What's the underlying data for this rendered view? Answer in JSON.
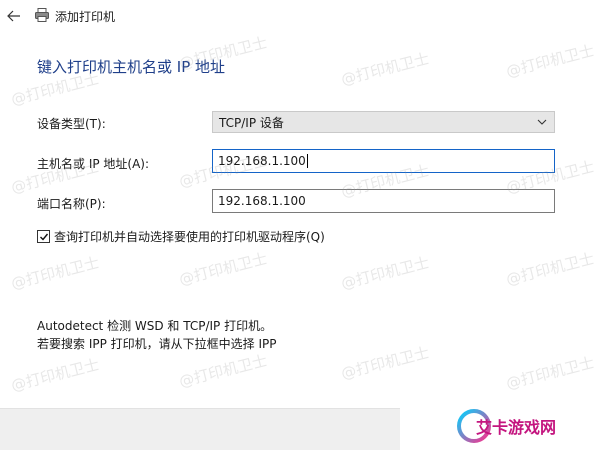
{
  "window": {
    "title": "添加打印机"
  },
  "heading": "键入打印机主机名或 IP 地址",
  "form": {
    "device_type_label": "设备类型(T):",
    "device_type_value": "TCP/IP 设备",
    "hostname_label": "主机名或 IP 地址(A):",
    "hostname_value": "192.168.1.100",
    "port_label": "端口名称(P):",
    "port_value": "192.168.1.100",
    "query_driver_label": "查询打印机并自动选择要使用的打印机驱动程序(Q)",
    "query_driver_checked": true
  },
  "info": {
    "line1": "Autodetect 检测 WSD 和 TCP/IP 打印机。",
    "line2": "若要搜索 IPP 打印机，请从下拉框中选择 IPP"
  },
  "watermark": {
    "text": "@打印机卫士"
  },
  "logo": {
    "text": "艾卡游戏网"
  },
  "icons": {
    "back": "back-arrow-icon",
    "printer": "printer-icon",
    "dropdown": "chevron-down-icon",
    "checkbox": "checkmark-icon"
  },
  "colors": {
    "heading": "#1f3f8a",
    "focus_border": "#1464c8",
    "footer_bg": "#efefef",
    "logo": "#c4157f"
  }
}
